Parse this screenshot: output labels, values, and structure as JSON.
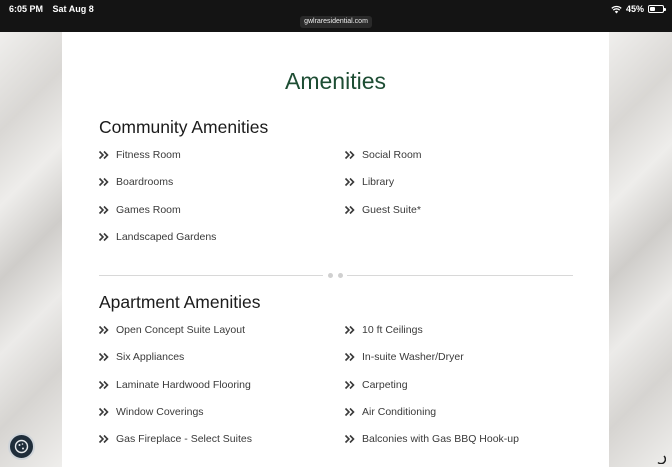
{
  "status_bar": {
    "time": "6:05 PM",
    "date": "Sat Aug 8",
    "url": "gwlraresidential.com",
    "battery": "45%",
    "battery_level": 0.45
  },
  "page": {
    "title": "Amenities"
  },
  "community": {
    "title": "Community Amenities",
    "left": [
      "Fitness Room",
      "Boardrooms",
      "Games Room",
      "Landscaped Gardens"
    ],
    "right": [
      "Social Room",
      "Library",
      "Guest Suite*"
    ]
  },
  "apartment": {
    "title": "Apartment Amenities",
    "left": [
      "Open Concept Suite Layout",
      "Six Appliances",
      "Laminate Hardwood Flooring",
      "Window Coverings",
      "Gas Fireplace - Select Suites"
    ],
    "right": [
      "10 ft Ceilings",
      "In-suite Washer/Dryer",
      "Carpeting",
      "Air Conditioning",
      "Balconies with Gas BBQ Hook-up"
    ]
  },
  "icons": {
    "list_bullet": "double-chevron-right-icon",
    "cookie": "cookie-icon",
    "wifi": "wifi-icon",
    "battery": "battery-icon"
  },
  "colors": {
    "title_green": "#1d4d33",
    "status_bar": "#141414"
  }
}
